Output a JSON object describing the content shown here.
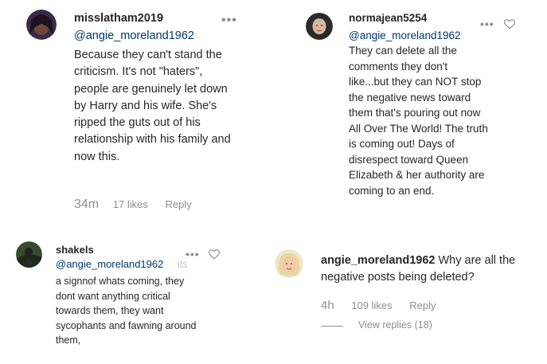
{
  "comments": [
    {
      "username": "misslatham2019",
      "mention": "@angie_moreland1962",
      "text": "Because they can't stand the criticism. It's not \"haters\", people are genuinely let down by Harry and his wife. She's ripped the guts out of his relationship with his family and now this.",
      "time": "34m",
      "likes": "17 likes",
      "reply": "Reply",
      "more_icon": "more-dots-icon"
    },
    {
      "username": "normajean5254",
      "mention": "@angie_moreland1962",
      "text": "They can delete all the comments they don't like...but they can NOT stop the negative news toward them that's pouring out now All Over The World! The truth is coming out! Days of disrespect toward Queen Elizabeth & her authority are coming to an end.",
      "more_icon": "more-dots-icon",
      "like_icon": "heart-outline-icon"
    },
    {
      "username": "shakels",
      "mention": "@angie_moreland1962",
      "mention_tail": "its",
      "text": "a signnof whats coming, they dont want anything critical towards them, they want sycophants and fawning around them,",
      "more_icon": "more-dots-icon",
      "like_icon": "heart-outline-icon"
    },
    {
      "username": "angie_moreland1962",
      "text": "Why are all the negative posts being deleted?",
      "time": "4h",
      "likes": "109 likes",
      "reply": "Reply",
      "view_replies": "View replies (18)"
    }
  ],
  "colors": {
    "text": "#262626",
    "mention": "#00376b",
    "meta": "#8e8e8e"
  }
}
